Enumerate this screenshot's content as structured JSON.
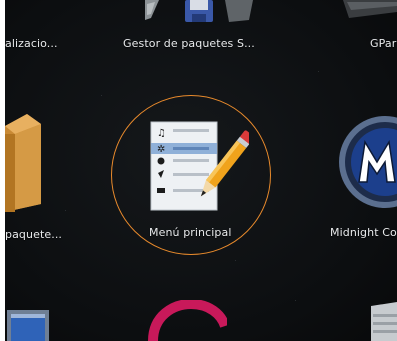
{
  "colors": {
    "background": "#0c0e10",
    "label_text": "#e9ebed",
    "selection_ring": "#e88a2c"
  },
  "apps": [
    {
      "id": "actualizacion",
      "label": "alizacio...",
      "icon": "update-icon"
    },
    {
      "id": "gestor-paquetes",
      "label": "Gestor de paquetes S...",
      "icon": "floppy-disk-icon"
    },
    {
      "id": "gparted",
      "label": "GPar",
      "icon": "gparted-icon"
    },
    {
      "id": "paquetes",
      "label": "paquete...",
      "icon": "package-box-icon"
    },
    {
      "id": "menu-principal",
      "label": "Menú principal",
      "icon": "menu-editor-icon",
      "selected": true
    },
    {
      "id": "midnight-commander",
      "label": "Midnight Co",
      "icon": "midnight-commander-icon"
    },
    {
      "id": "row3-left",
      "label": "",
      "icon": "window-icon"
    },
    {
      "id": "row3-center",
      "label": "",
      "icon": "debian-swirl-icon"
    },
    {
      "id": "row3-right",
      "label": "",
      "icon": "server-icon"
    }
  ]
}
